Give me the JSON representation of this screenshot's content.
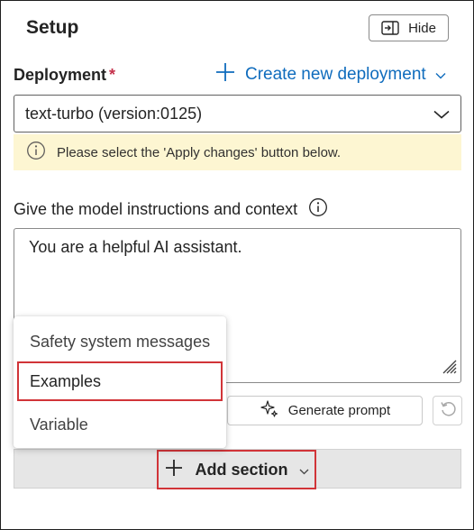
{
  "panel": {
    "title": "Setup",
    "hide_label": "Hide"
  },
  "deployment": {
    "label": "Deployment",
    "required_marker": "*",
    "create_label": "Create new deployment",
    "selected_value": "text-turbo (version:0125)"
  },
  "info": {
    "message": "Please select the 'Apply changes' button below."
  },
  "instructions": {
    "label": "Give the model instructions and context",
    "value": "You are a helpful AI assistant."
  },
  "actions": {
    "generate_label": "Generate prompt",
    "add_section_label": "Add section"
  },
  "add_section_menu": {
    "items": [
      {
        "label": "Safety system messages"
      },
      {
        "label": "Examples"
      },
      {
        "label": "Variable"
      }
    ]
  },
  "colors": {
    "accent": "#0f6cbd",
    "highlight": "#d13438",
    "info_bg": "#fdf6d2",
    "required": "#c4314b"
  }
}
